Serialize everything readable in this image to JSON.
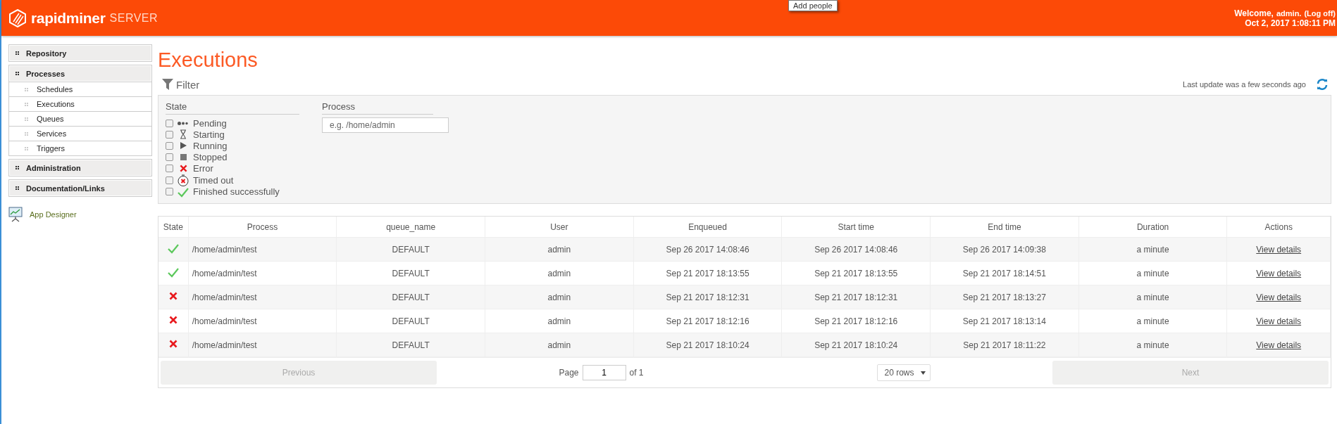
{
  "header": {
    "logo_text": "rapidminer",
    "logo_suffix": "SERVER",
    "tooltip": "Add people",
    "welcome": "Welcome,",
    "user": "admin.",
    "logoff": "(Log off)",
    "datetime": "Oct 2, 2017 1:08:11 PM"
  },
  "sidebar": {
    "sections": [
      {
        "label": "Repository"
      },
      {
        "label": "Processes",
        "children": [
          {
            "label": "Schedules",
            "selected": false
          },
          {
            "label": "Executions",
            "selected": false
          },
          {
            "label": "Queues",
            "selected": false
          },
          {
            "label": "Services",
            "selected": false
          },
          {
            "label": "Triggers",
            "selected": false
          }
        ]
      },
      {
        "label": "Administration"
      },
      {
        "label": "Documentation/Links"
      }
    ],
    "app_designer": "App Designer"
  },
  "page_title": "Executions",
  "filter": {
    "title": "Filter",
    "last_update": "Last update was a few seconds ago",
    "state_label": "State",
    "states": [
      {
        "label": "Pending",
        "kind": "pending",
        "checked": false
      },
      {
        "label": "Starting",
        "kind": "starting",
        "checked": false
      },
      {
        "label": "Running",
        "kind": "running",
        "checked": false
      },
      {
        "label": "Stopped",
        "kind": "stopped",
        "checked": false
      },
      {
        "label": "Error",
        "kind": "error",
        "checked": false
      },
      {
        "label": "Timed out",
        "kind": "timeout",
        "checked": false
      },
      {
        "label": "Finished successfully",
        "kind": "success",
        "checked": false
      }
    ],
    "process_label": "Process",
    "process_placeholder": "e.g. /home/admin"
  },
  "table": {
    "columns": [
      "State",
      "Process",
      "queue_name",
      "User",
      "Enqueued",
      "Start time",
      "End time",
      "Duration",
      "Actions"
    ],
    "rows": [
      {
        "kind": "success",
        "process": "/home/admin/test",
        "queue": "DEFAULT",
        "user": "admin",
        "enqueued": "Sep 26 2017 14:08:46",
        "start": "Sep 26 2017 14:08:46",
        "end": "Sep 26 2017 14:09:38",
        "duration": "a minute",
        "action": "View details"
      },
      {
        "kind": "success",
        "process": "/home/admin/test",
        "queue": "DEFAULT",
        "user": "admin",
        "enqueued": "Sep 21 2017 18:13:55",
        "start": "Sep 21 2017 18:13:55",
        "end": "Sep 21 2017 18:14:51",
        "duration": "a minute",
        "action": "View details"
      },
      {
        "kind": "error",
        "process": "/home/admin/test",
        "queue": "DEFAULT",
        "user": "admin",
        "enqueued": "Sep 21 2017 18:12:31",
        "start": "Sep 21 2017 18:12:31",
        "end": "Sep 21 2017 18:13:27",
        "duration": "a minute",
        "action": "View details"
      },
      {
        "kind": "error",
        "process": "/home/admin/test",
        "queue": "DEFAULT",
        "user": "admin",
        "enqueued": "Sep 21 2017 18:12:16",
        "start": "Sep 21 2017 18:12:16",
        "end": "Sep 21 2017 18:13:14",
        "duration": "a minute",
        "action": "View details"
      },
      {
        "kind": "error",
        "process": "/home/admin/test",
        "queue": "DEFAULT",
        "user": "admin",
        "enqueued": "Sep 21 2017 18:10:24",
        "start": "Sep 21 2017 18:10:24",
        "end": "Sep 21 2017 18:11:22",
        "duration": "a minute",
        "action": "View details"
      }
    ]
  },
  "pagination": {
    "previous": "Previous",
    "page_label": "Page",
    "page_value": "1",
    "of_label": "of 1",
    "rows_select": "20 rows",
    "next": "Next"
  }
}
